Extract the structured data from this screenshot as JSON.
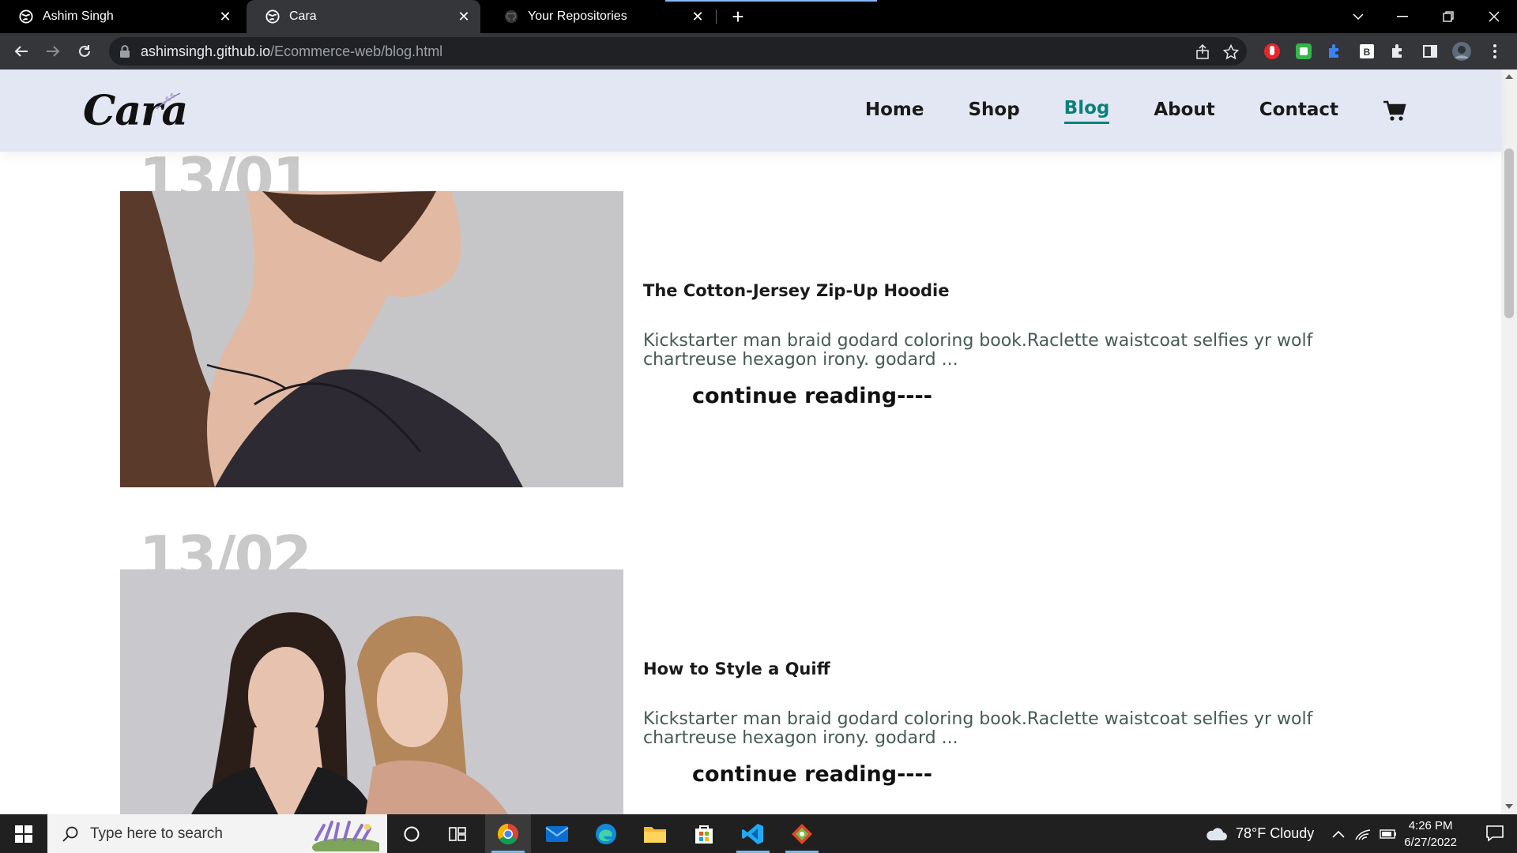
{
  "browser": {
    "tabs": [
      {
        "title": "Ashim Singh",
        "active": false
      },
      {
        "title": "Cara",
        "active": true
      },
      {
        "title": "Your Repositories",
        "active": false
      }
    ],
    "url_host": "ashimsingh.github.io",
    "url_path": "/Ecommerce-web/blog.html"
  },
  "site": {
    "logo": "Cara",
    "nav": [
      {
        "label": "Home",
        "active": false
      },
      {
        "label": "Shop",
        "active": false
      },
      {
        "label": "Blog",
        "active": true
      },
      {
        "label": "About",
        "active": false
      },
      {
        "label": "Contact",
        "active": false
      }
    ],
    "accent_color": "#088178",
    "header_bg": "#e3e6f3"
  },
  "posts": [
    {
      "date": "13/01",
      "title": "The Cotton-Jersey Zip-Up Hoodie",
      "excerpt": "Kickstarter man braid godard coloring book.Raclette waistcoat selfies yr wolf chartreuse hexagon irony. godard ...",
      "cta": "continue reading----"
    },
    {
      "date": "13/02",
      "title": "How to Style a Quiff",
      "excerpt": "Kickstarter man braid godard coloring book.Raclette waistcoat selfies yr wolf chartreuse hexagon irony. godard ...",
      "cta": "continue reading----"
    }
  ],
  "taskbar": {
    "search_placeholder": "Type here to search",
    "weather": "78°F  Cloudy",
    "time": "4:26 PM",
    "date": "6/27/2022"
  }
}
